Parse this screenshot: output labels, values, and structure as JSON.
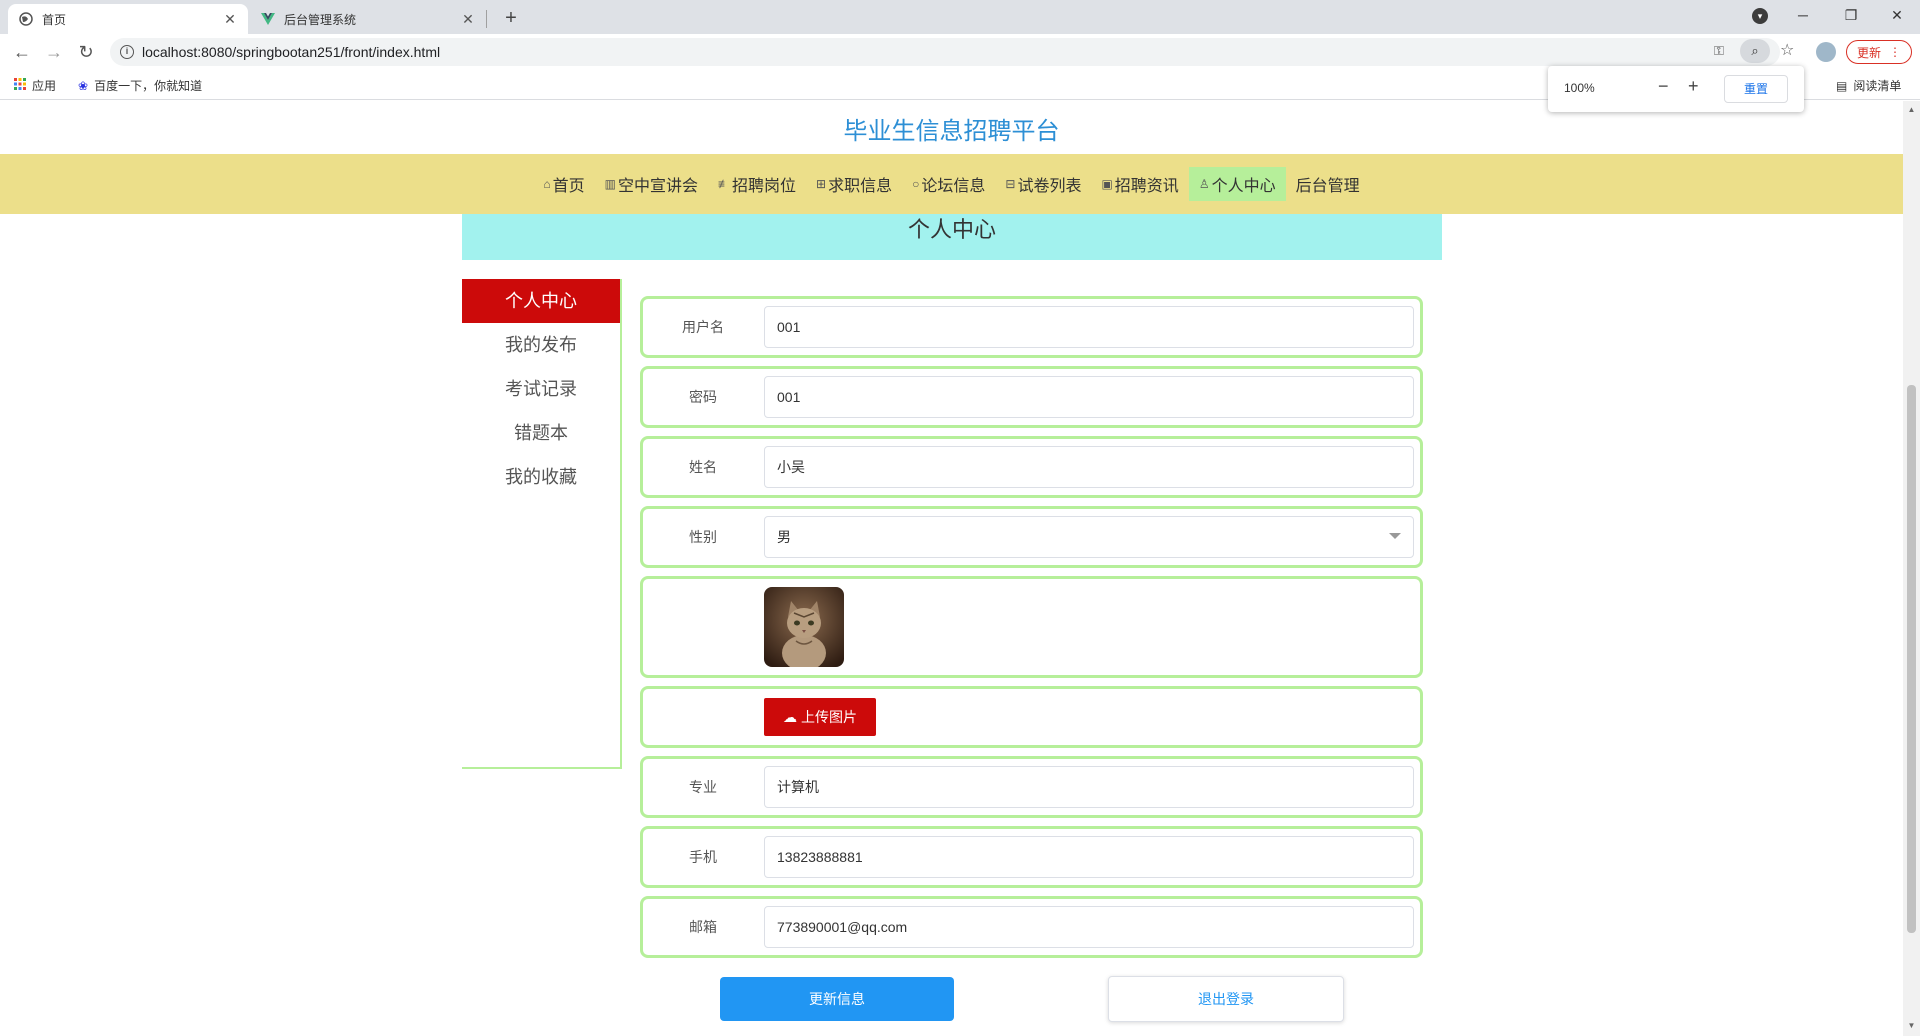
{
  "browser": {
    "tabs": [
      {
        "title": "首页",
        "active": true
      },
      {
        "title": "后台管理系统",
        "active": false
      }
    ],
    "new_tab_icon": "+",
    "url": "localhost:8080/springbootan251/front/index.html",
    "update_label": "更新",
    "bookmarks": [
      {
        "label": "应用",
        "icon": "apps-icon"
      },
      {
        "label": "百度一下，你就知道",
        "icon": "baidu-paw-icon"
      }
    ],
    "reading_list_label": "阅读清单",
    "zoom_popup": {
      "value": "100%",
      "reset_label": "重置"
    }
  },
  "page": {
    "site_title": "毕业生信息招聘平台",
    "nav": [
      {
        "label": "首页",
        "icon": "home-icon",
        "active": false
      },
      {
        "label": "空中宣讲会",
        "icon": "grid-icon",
        "active": false
      },
      {
        "label": "招聘岗位",
        "icon": "sliders-icon",
        "active": false
      },
      {
        "label": "求职信息",
        "icon": "list-icon",
        "active": false
      },
      {
        "label": "论坛信息",
        "icon": "chat-icon",
        "active": false
      },
      {
        "label": "试卷列表",
        "icon": "blocks-icon",
        "active": false
      },
      {
        "label": "招聘资讯",
        "icon": "doc-icon",
        "active": false
      },
      {
        "label": "个人中心",
        "icon": "user-icon",
        "active": true
      },
      {
        "label": "后台管理",
        "icon": "",
        "active": false
      }
    ],
    "banner_title": "个人中心",
    "sidebar": [
      {
        "label": "个人中心",
        "active": true
      },
      {
        "label": "我的发布",
        "active": false
      },
      {
        "label": "考试记录",
        "active": false
      },
      {
        "label": "错题本",
        "active": false
      },
      {
        "label": "我的收藏",
        "active": false
      }
    ],
    "form": {
      "username_label": "用户名",
      "username_value": "001",
      "password_label": "密码",
      "password_value": "001",
      "name_label": "姓名",
      "name_value": "小吴",
      "gender_label": "性别",
      "gender_value": "男",
      "upload_label": "上传图片",
      "major_label": "专业",
      "major_value": "计算机",
      "phone_label": "手机",
      "phone_value": "13823888881",
      "email_label": "邮箱",
      "email_value": "773890001@qq.com"
    },
    "update_button": "更新信息",
    "logout_button": "退出登录"
  },
  "colors": {
    "accent_blue": "#2196f3",
    "nav_bg": "#ecdf8a",
    "nav_active": "#b6ef9a",
    "banner_bg": "#a2f2ee",
    "sidebar_active": "#cc0a0a",
    "title_blue": "#2d8fd5"
  }
}
